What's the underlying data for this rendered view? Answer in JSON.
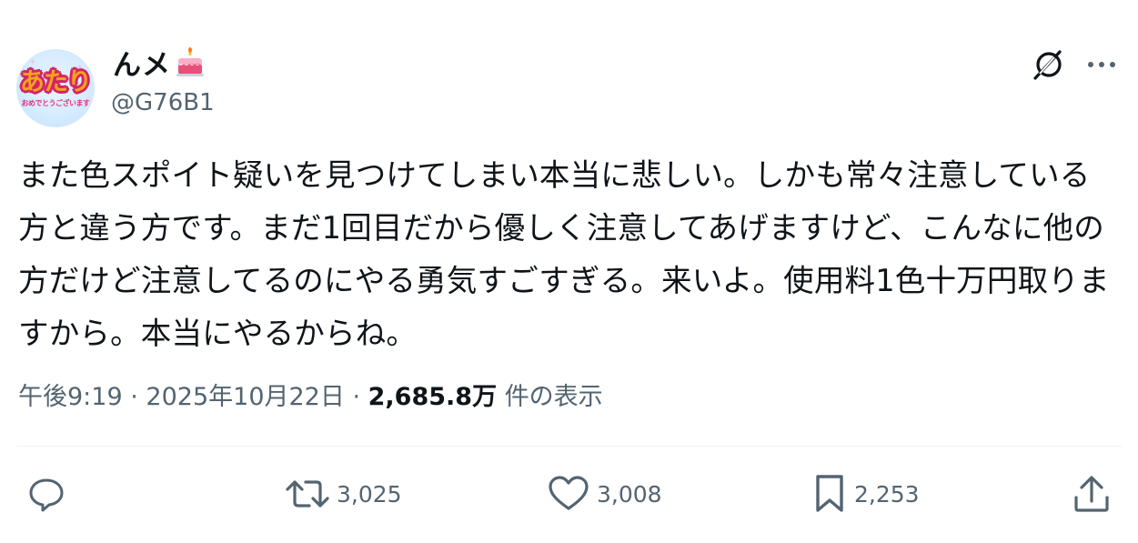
{
  "author": {
    "display_name": "んメ",
    "handle": "@G76B1",
    "avatar_text": "あたり",
    "avatar_subtext": "おめでとうございます",
    "badge_icon": "birthday-cake-emoji"
  },
  "tweet": {
    "text": "また色スポイト疑いを見つけてしまい本当に悲しい。しかも常々注意している方と違う方です。まだ1回目だから優しく注意してあげますけど、こんなに他の方だけど注意してるのにやる勇気すごすぎる。来いよ。使用料1色十万円取りますから。本当にやるからね。",
    "time": "午後9:19",
    "date": "2025年10月22日",
    "separator": "·",
    "views_count": "2,685.8万",
    "views_label": "件の表示"
  },
  "header_actions": {
    "grok_icon": "grok-icon",
    "more_icon": "more-dots-icon"
  },
  "actions": {
    "reply": {
      "icon": "reply-icon",
      "count": ""
    },
    "retweet": {
      "icon": "retweet-icon",
      "count": "3,025"
    },
    "like": {
      "icon": "heart-icon",
      "count": "3,008"
    },
    "bookmark": {
      "icon": "bookmark-icon",
      "count": "2,253"
    },
    "share": {
      "icon": "share-icon",
      "count": ""
    }
  },
  "colors": {
    "text_primary": "#0f1419",
    "text_secondary": "#536471",
    "divider": "#eff3f4"
  }
}
